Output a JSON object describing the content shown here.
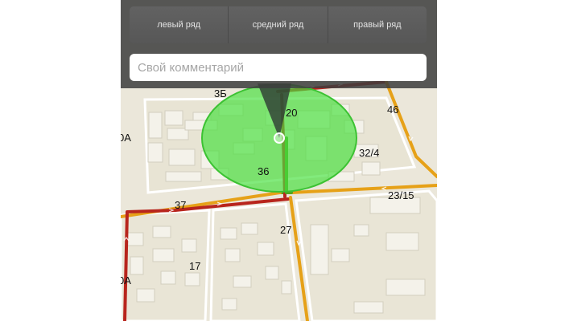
{
  "lanes": {
    "left": "левый ряд",
    "middle": "средний ряд",
    "right": "правый ряд"
  },
  "comment": {
    "placeholder": "Свой комментарий",
    "value": ""
  },
  "map": {
    "labels": {
      "b3": "3Б",
      "n20": "20",
      "n46": "46",
      "a0": "0А",
      "n32_4": "32/4",
      "n36": "36",
      "n23_15": "23/15",
      "n37": "37",
      "n27": "27",
      "n17": "17",
      "a0b": "0А"
    },
    "colors": {
      "jam": "#b8251d",
      "slow": "#e6a118",
      "free": "#4fa520",
      "zone": "#47e03e"
    }
  }
}
